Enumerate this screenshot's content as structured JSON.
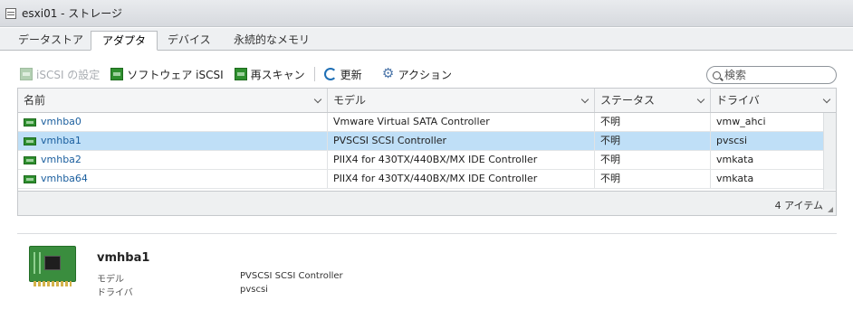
{
  "window": {
    "title": "esxi01 - ストレージ",
    "icon": "storage-icon"
  },
  "tabs": [
    {
      "label": "データストア",
      "active": false
    },
    {
      "label": "アダプタ",
      "active": true
    },
    {
      "label": "デバイス",
      "active": false
    },
    {
      "label": "永続的なメモリ",
      "active": false
    }
  ],
  "toolbar": {
    "iscsi_settings": "iSCSI の設定",
    "software_iscsi": "ソフトウェア iSCSI",
    "rescan": "再スキャン",
    "refresh": "更新",
    "actions": "アクション"
  },
  "search": {
    "placeholder": "検索",
    "value": ""
  },
  "grid": {
    "columns": [
      "名前",
      "モデル",
      "ステータス",
      "ドライバ"
    ],
    "rows": [
      {
        "name": "vmhba0",
        "model": "Vmware Virtual SATA Controller",
        "status": "不明",
        "driver": "vmw_ahci",
        "selected": false
      },
      {
        "name": "vmhba1",
        "model": "PVSCSI SCSI Controller",
        "status": "不明",
        "driver": "pvscsi",
        "selected": true
      },
      {
        "name": "vmhba2",
        "model": "PIIX4 for 430TX/440BX/MX IDE Controller",
        "status": "不明",
        "driver": "vmkata",
        "selected": false
      },
      {
        "name": "vmhba64",
        "model": "PIIX4 for 430TX/440BX/MX IDE Controller",
        "status": "不明",
        "driver": "vmkata",
        "selected": false
      }
    ],
    "footer_count": "4 アイテム"
  },
  "detail": {
    "title": "vmhba1",
    "model_label": "モデル",
    "model_value": "PVSCSI SCSI Controller",
    "driver_label": "ドライバ",
    "driver_value": "pvscsi"
  },
  "colors": {
    "selected_row": "#bfdff7",
    "link": "#1a5e9e",
    "accent": "#1f6fb5"
  }
}
